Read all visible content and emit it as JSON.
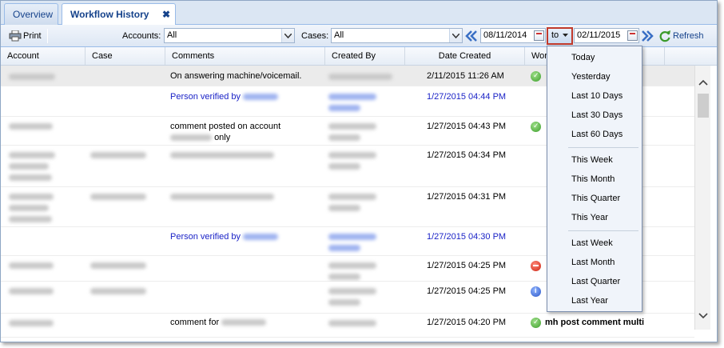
{
  "tabs": [
    {
      "label": "Overview"
    },
    {
      "label": "Workflow History"
    }
  ],
  "toolbar": {
    "print_label": "Print",
    "accounts_label": "Accounts:",
    "accounts_value": "All",
    "cases_label": "Cases:",
    "cases_value": "All",
    "date_from": "08/11/2014",
    "to_label": "to",
    "date_to": "02/11/2015",
    "refresh_label": "Refresh"
  },
  "columns": {
    "account": "Account",
    "case": "Case",
    "comments": "Comments",
    "created_by": "Created By",
    "date_created": "Date Created",
    "workflow": "Wor"
  },
  "rows": [
    {
      "comment": "On answering machine/voicemail.",
      "date": "2/11/2015 11:26 AM",
      "status": "ok"
    },
    {
      "comment": "Person verified by",
      "date": "1/27/2015 04:44 PM",
      "status": "none"
    },
    {
      "comment": "comment posted on account",
      "comment2": "only",
      "date": "1/27/2015 04:43 PM",
      "status": "ok"
    },
    {
      "comment": "",
      "date": "1/27/2015 04:34 PM",
      "status": "none"
    },
    {
      "comment": "",
      "date": "1/27/2015 04:31 PM",
      "status": "none"
    },
    {
      "comment": "Person verified by",
      "date": "1/27/2015 04:30 PM",
      "status": "none"
    },
    {
      "comment": "",
      "date": "1/27/2015 04:25 PM",
      "status": "no"
    },
    {
      "comment": "",
      "date": "1/27/2015 04:25 PM",
      "status": "info"
    },
    {
      "comment": "comment for",
      "date": "1/27/2015 04:20 PM",
      "status": "ok",
      "workflow": "mh post comment multi"
    }
  ],
  "dropdown": {
    "items": [
      "Today",
      "Yesterday",
      "Last 10 Days",
      "Last 30 Days",
      "Last 60 Days",
      "This Week",
      "This Month",
      "This Quarter",
      "This Year",
      "Last Week",
      "Last Month",
      "Last Quarter",
      "Last Year"
    ]
  },
  "colors": {
    "accent": "#15428b",
    "highlight_border": "#c0392b",
    "link_blue": "#1b23c7"
  }
}
